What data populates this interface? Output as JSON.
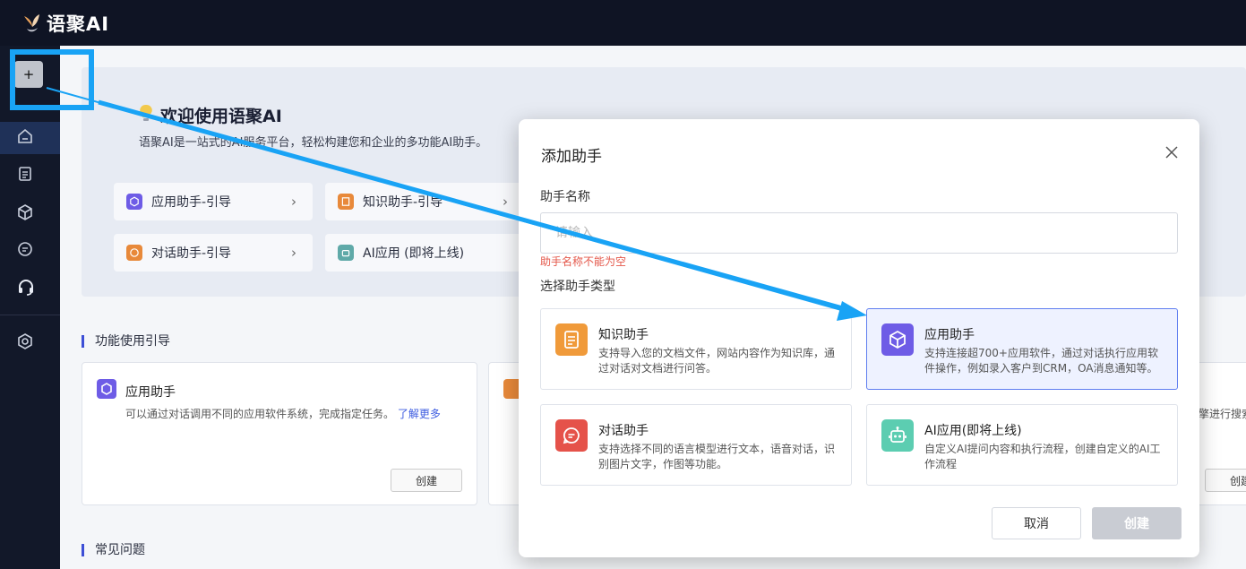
{
  "app": {
    "name": "语聚AI"
  },
  "sidebar": {
    "add_label": "+"
  },
  "welcome": {
    "title": "欢迎使用语聚AI",
    "subtitle": "语聚AI是一站式的AI服务平台，轻松构建您和企业的多功能AI助手。",
    "guides": [
      {
        "label": "应用助手-引导"
      },
      {
        "label": "知识助手-引导"
      },
      {
        "label": "对话助手-引导"
      },
      {
        "label": "AI应用 (即将上线)"
      }
    ]
  },
  "sections": {
    "feature_guide": "功能使用引导",
    "faq": "常见问题"
  },
  "features": [
    {
      "title": "应用助手",
      "desc": "可以通过对话调用不同的应用软件系统，完成指定任务。",
      "link": "了解更多",
      "button": "创建"
    },
    {
      "right_clip": "擎进行搜索",
      "button": "创建"
    }
  ],
  "modal": {
    "title": "添加助手",
    "name_label": "助手名称",
    "name_placeholder": "请输入",
    "name_error": "助手名称不能为空",
    "type_label": "选择助手类型",
    "types": [
      {
        "title": "知识助手",
        "desc": "支持导入您的文档文件，网站内容作为知识库，通过对话对文档进行问答。",
        "color": "#f09a3a"
      },
      {
        "title": "应用助手",
        "desc": "支持连接超700+应用软件，通过对话执行应用软件操作，例如录入客户到CRM，OA消息通知等。",
        "color": "#6e5ce6",
        "selected": true
      },
      {
        "title": "对话助手",
        "desc": "支持选择不同的语言模型进行文本，语音对话，识别图片文字，作图等功能。",
        "color": "#e5524a"
      },
      {
        "title": "AI应用(即将上线)",
        "desc": "自定义AI提问内容和执行流程，创建自定义的AI工作流程",
        "color": "#5ccdb1"
      }
    ],
    "cancel_label": "取消",
    "create_label": "创建"
  },
  "colors": {
    "accent": "#19a3f5",
    "topbar": "#0f1424",
    "error": "#e4574a",
    "selected_border": "#5f7ef0"
  }
}
